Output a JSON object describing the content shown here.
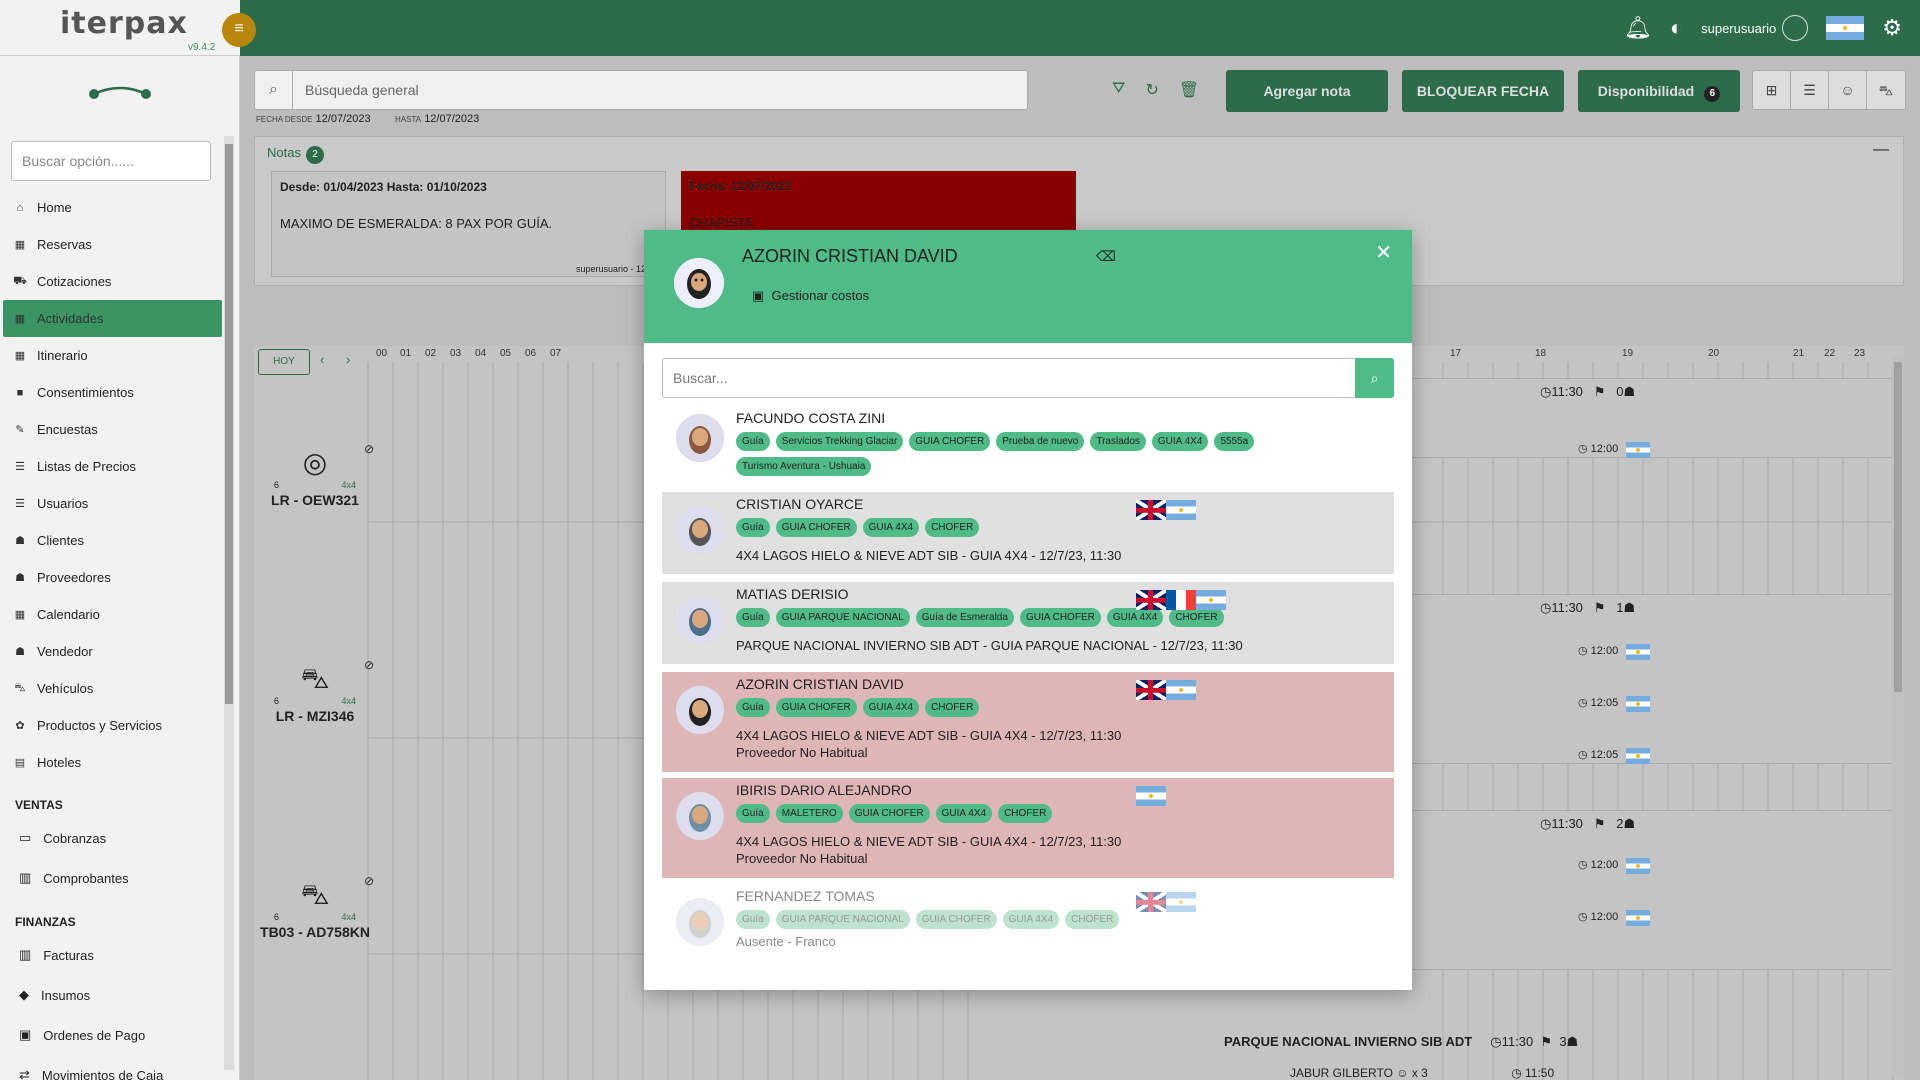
{
  "app": {
    "logo": "iterpax",
    "version": "v9.4.2"
  },
  "header": {
    "user": "superusuario"
  },
  "sidebar": {
    "search_placeholder": "Buscar opción......",
    "items": [
      {
        "icon": "home-icon",
        "glyph": "⌂",
        "label": "Home"
      },
      {
        "icon": "calendar-icon",
        "glyph": "▦",
        "label": "Reservas"
      },
      {
        "icon": "cart-icon",
        "glyph": "⛟",
        "label": "Cotizaciones"
      },
      {
        "icon": "calendar-icon",
        "glyph": "▦",
        "label": "Actividades",
        "active": true
      },
      {
        "icon": "calendar-icon",
        "glyph": "▦",
        "label": "Itinerario"
      },
      {
        "icon": "book-icon",
        "glyph": "■",
        "label": "Consentimientos"
      },
      {
        "icon": "edit-icon",
        "glyph": "✎",
        "label": "Encuestas"
      },
      {
        "icon": "list-icon",
        "glyph": "☰",
        "label": "Listas de Precios"
      },
      {
        "icon": "list-icon",
        "glyph": "☰",
        "label": "Usuarios"
      },
      {
        "icon": "users-icon",
        "glyph": "☗",
        "label": "Clientes"
      },
      {
        "icon": "users-icon",
        "glyph": "☗",
        "label": "Proveedores"
      },
      {
        "icon": "calendar-icon",
        "glyph": "▦",
        "label": "Calendario"
      },
      {
        "icon": "users-icon",
        "glyph": "☗",
        "label": "Vendedor"
      },
      {
        "icon": "car-icon",
        "glyph": "⛍",
        "label": "Vehículos"
      },
      {
        "icon": "gift-icon",
        "glyph": "✿",
        "label": "Productos y Servicios"
      },
      {
        "icon": "building-icon",
        "glyph": "▤",
        "label": "Hoteles"
      }
    ],
    "ventas_title": "VENTAS",
    "ventas": [
      {
        "icon": "card-icon",
        "glyph": "▭",
        "label": "Cobranzas"
      },
      {
        "icon": "barcode-icon",
        "glyph": "▥",
        "label": "Comprobantes"
      }
    ],
    "finanzas_title": "FINANZAS",
    "finanzas": [
      {
        "icon": "barcode-icon",
        "glyph": "▥",
        "label": "Facturas"
      },
      {
        "icon": "tag-icon",
        "glyph": "◆",
        "label": "Insumos"
      },
      {
        "icon": "money-icon",
        "glyph": "▣",
        "label": "Ordenes de Pago"
      },
      {
        "icon": "exchange-icon",
        "glyph": "⇄",
        "label": "Movimientos de Caja"
      }
    ]
  },
  "toolbar": {
    "search_placeholder": "Búsqueda general",
    "fecha_desde_label": "Fecha desde",
    "fecha_desde": "12/07/2023",
    "hasta_label": "Hasta",
    "fecha_hasta": "12/07/2023",
    "add_note": "Agregar nota",
    "block_date": "BLOQUEAR FECHA",
    "availability": "Disponibilidad",
    "availability_count": "6"
  },
  "notes": {
    "title": "Notas",
    "count": "2",
    "note1_range": "Desde: 01/04/2023 Hasta: 01/10/2023",
    "note1_text": "MAXIMO DE ESMERALDA: 8 PAX POR GUÍA.",
    "note1_author": "superusuario - 12/08/",
    "note2_date": "Fecha: 12/07/2023",
    "note2_text": "CHAPISTA"
  },
  "calendar": {
    "today": "HOY",
    "hours_left": [
      "00",
      "01",
      "02",
      "03",
      "04",
      "05",
      "06",
      "07"
    ],
    "hours_right": [
      "17",
      "18",
      "19",
      "20",
      "21",
      "22",
      "23"
    ],
    "vehicles": [
      {
        "name": "LR - OEW321",
        "cap": "6",
        "type": "4x4"
      },
      {
        "name": "LR - MZI346",
        "cap": "6",
        "type": "4x4"
      },
      {
        "name": "TB03 - AD758KN",
        "cap": "6",
        "type": "4x4"
      }
    ],
    "block_times": [
      "11:30",
      "11:30",
      "11:30",
      "11:30"
    ],
    "block_counts": [
      "0",
      "1",
      "2",
      "3"
    ],
    "sub_times": [
      "12:00",
      "12:00",
      "12:05",
      "12:05",
      "12:00",
      "12:00",
      "11:50"
    ],
    "bottom_activity": "PARQUE NACIONAL INVIERNO SIB ADT",
    "bottom_guest": "JABUR GILBERTO",
    "bottom_guest_count": "x 3"
  },
  "modal": {
    "title": "AZORIN CRISTIAN DAVID",
    "manage_costs": "Gestionar costos",
    "search_placeholder": "Buscar...",
    "rows": [
      {
        "name": "FACUNDO COSTA ZINI",
        "tags": [
          "Guía",
          "Servicios Trekking Glaciar",
          "GUIA CHOFER",
          "Prueba de nuevo",
          "Traslados",
          "GUIA 4X4",
          "5555a",
          "Turismo Aventura - Ushuaia"
        ],
        "lines": [],
        "flags": []
      },
      {
        "name": "CRISTIAN OYARCE",
        "tags": [
          "Guía",
          "GUIA CHOFER",
          "GUIA 4X4",
          "CHOFER"
        ],
        "lines": [
          "4X4 LAGOS HIELO & NIEVE ADT SIB - GUIA 4X4 - 12/7/23, 11:30"
        ],
        "flags": [
          "uk",
          "ar"
        ]
      },
      {
        "name": "MATIAS DERISIO",
        "tags": [
          "Guía",
          "GUIA PARQUE NACIONAL",
          "Guía de Esmeralda",
          "GUIA CHOFER",
          "GUIA 4X4",
          "CHOFER"
        ],
        "lines": [
          "PARQUE NACIONAL INVIERNO SIB ADT - GUIA PARQUE NACIONAL - 12/7/23, 11:30"
        ],
        "flags": [
          "uk",
          "fr",
          "ar"
        ]
      },
      {
        "name": "AZORIN CRISTIAN DAVID",
        "tags": [
          "Guía",
          "GUIA CHOFER",
          "GUIA 4X4",
          "CHOFER"
        ],
        "lines": [
          "4X4 LAGOS HIELO & NIEVE ADT SIB - GUIA 4X4 - 12/7/23, 11:30",
          "Proveedor No Habitual"
        ],
        "flags": [
          "uk",
          "ar"
        ]
      },
      {
        "name": "IBIRIS DARIO ALEJANDRO",
        "tags": [
          "Guía",
          "MALETERO",
          "GUIA CHOFER",
          "GUIA 4X4",
          "CHOFER"
        ],
        "lines": [
          "4X4 LAGOS HIELO & NIEVE ADT SIB - GUIA 4X4 - 12/7/23, 11:30",
          "Proveedor No Habitual"
        ],
        "flags": [
          "ar"
        ]
      },
      {
        "name": "FERNANDEZ TOMAS",
        "tags": [
          "Guía",
          "GUIA PARQUE NACIONAL",
          "GUIA CHOFER",
          "GUIA 4X4",
          "CHOFER"
        ],
        "lines": [
          "Ausente - Franco"
        ],
        "flags": [
          "uk",
          "ar"
        ]
      }
    ]
  },
  "colors": {
    "brand": "#2c6c49",
    "accent": "#4fbb86",
    "busy": "#dfb6b6",
    "assigned": "#e0e0e0"
  }
}
